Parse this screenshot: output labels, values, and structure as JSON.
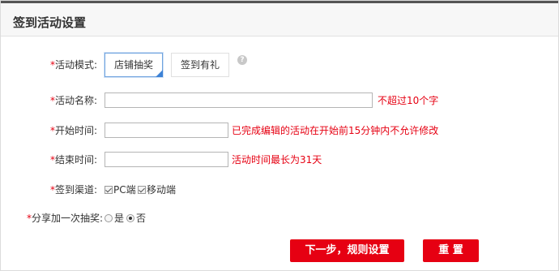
{
  "panel": {
    "title": "签到活动设置"
  },
  "colors": {
    "required": "#e60012",
    "button_bg": "#e60012",
    "active_border": "#6fa3df"
  },
  "form": {
    "mode": {
      "required_mark": "*",
      "label": "活动模式:",
      "options": [
        "店铺抽奖",
        "签到有礼"
      ],
      "selected": "店铺抽奖",
      "help_icon": "question-circle-icon",
      "help_glyph": "?"
    },
    "name": {
      "required_mark": "*",
      "label": "活动名称:",
      "value": "",
      "hint": "不超过10个字"
    },
    "start_time": {
      "required_mark": "*",
      "label": "开始时间:",
      "value": "",
      "hint": "已完成编辑的活动在开始前15分钟内不允许修改"
    },
    "end_time": {
      "required_mark": "*",
      "label": "结束时间:",
      "value": "",
      "hint": "活动时间最长为31天"
    },
    "channel": {
      "required_mark": "*",
      "label": "签到渠道:",
      "options": [
        {
          "label": "PC端",
          "checked": true
        },
        {
          "label": "移动端",
          "checked": true
        }
      ]
    },
    "share": {
      "required_mark": "*",
      "label": "分享加一次抽奖:",
      "options": [
        {
          "label": "是",
          "selected": false
        },
        {
          "label": "否",
          "selected": true
        }
      ]
    }
  },
  "actions": {
    "next_label": "下一步，规则设置",
    "reset_label": "重 置"
  }
}
